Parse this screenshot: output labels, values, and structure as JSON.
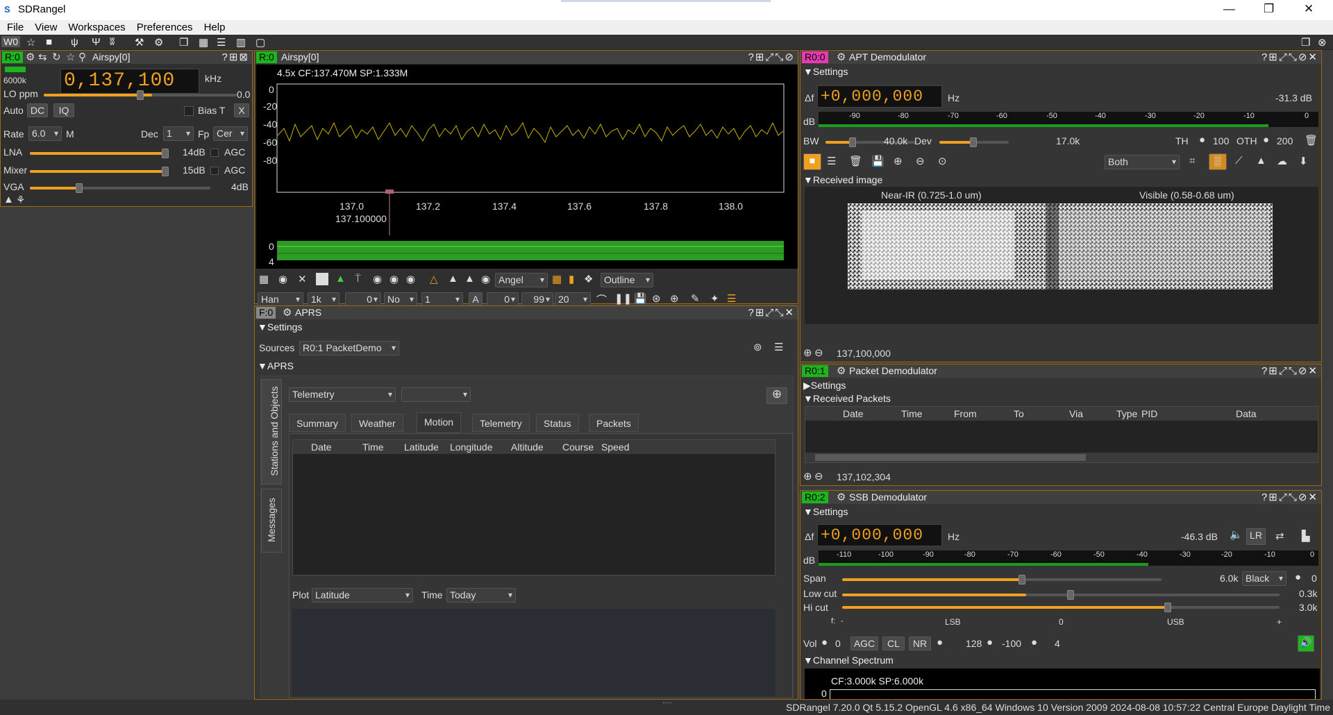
{
  "window": {
    "title": "SDRangel",
    "app_icon": "S"
  },
  "menu": [
    "File",
    "View",
    "Workspaces",
    "Preferences",
    "Help"
  ],
  "toolbar": {
    "workspace": "W0"
  },
  "device": {
    "tag": "R:0",
    "title": "Airspy[0]",
    "freq": "0,137,100",
    "unit": "kHz",
    "rate_val": "6000k",
    "lo_label": "LO ppm",
    "lo_val": "0.0",
    "auto": "Auto",
    "dc": "DC",
    "iq": "IQ",
    "biast": "Bias T",
    "x": "X",
    "rate": "Rate",
    "rate_sel": "6.0",
    "m": "M",
    "dec": "Dec",
    "dec_sel": "1",
    "fp": "Fp",
    "fp_sel": "Cer",
    "lna": "LNA",
    "lna_val": "14dB",
    "mixer": "Mixer",
    "mixer_val": "15dB",
    "vga": "VGA",
    "vga_val": "4dB",
    "agc": "AGC"
  },
  "spectrum": {
    "tag": "R:0",
    "title": "Airspy[0]",
    "info": "4.5x CF:137.470M SP:1.333M",
    "yticks": [
      "0",
      "-20",
      "-40",
      "-60",
      "-80"
    ],
    "xticks": [
      "137.0",
      "137.2",
      "137.4",
      "137.6",
      "137.8",
      "138.0"
    ],
    "marker": "137.100000",
    "wf_top": "0",
    "wf_bot": "4",
    "angel": "Angel",
    "outline": "Outline",
    "han": "Han",
    "k1": "1k",
    "zero": "0",
    "no": "No",
    "one": "1",
    "a": "A",
    "a_val": "0",
    "n99": "99",
    "n20": "20"
  },
  "aprs": {
    "tag": "F:0",
    "title": "APRS",
    "settings": "Settings",
    "sources": "Sources",
    "source_sel": "R0:1 PacketDemo",
    "aprs": "APRS",
    "telemetry_sel": "Telemetry",
    "vtab1": "Stations and Objects",
    "vtab2": "Messages",
    "tabs": [
      "Summary",
      "Weather",
      "Motion",
      "Telemetry",
      "Status",
      "Packets"
    ],
    "cols": [
      "Date",
      "Time",
      "Latitude",
      "Longitude",
      "Altitude",
      "Course",
      "Speed"
    ],
    "plot": "Plot",
    "plot_sel": "Latitude",
    "time": "Time",
    "time_sel": "Today"
  },
  "apt": {
    "tag": "R0:0",
    "title": "APT Demodulator",
    "settings": "Settings",
    "df": "Δf",
    "digits": "+0,000,000",
    "hz": "Hz",
    "level": "-31.3 dB",
    "db": "dB",
    "ticks": [
      "-90",
      "-80",
      "-70",
      "-60",
      "-50",
      "-40",
      "-30",
      "-20",
      "-10",
      "0"
    ],
    "bw": "BW",
    "bw_val": "40.0k",
    "dev": "Dev",
    "dev_val": "17.0k",
    "th_lbl": "TH",
    "th_val": "100",
    "oth_lbl": "OTH",
    "oth_val": "200",
    "both": "Both",
    "received": "Received image",
    "nearir": "Near-IR (0.725-1.0 um)",
    "visible": "Visible (0.58-0.68 um)",
    "freq": "137,100,000"
  },
  "packet": {
    "tag": "R0:1",
    "title": "Packet Demodulator",
    "settings": "Settings",
    "received": "Received Packets",
    "cols": [
      "Date",
      "Time",
      "From",
      "To",
      "Via",
      "Type",
      "PID",
      "Data"
    ],
    "freq": "137,102,304"
  },
  "ssb": {
    "tag": "R0:2",
    "title": "SSB Demodulator",
    "settings": "Settings",
    "df": "Δf",
    "digits": "+0,000,000",
    "hz": "Hz",
    "level": "-46.3 dB",
    "lr": "LR",
    "db": "dB",
    "ticks": [
      "-110",
      "-100",
      "-90",
      "-80",
      "-70",
      "-60",
      "-50",
      "-40",
      "-30",
      "-20",
      "-10",
      "0"
    ],
    "span": "Span",
    "span_val": "6.0k",
    "black": "Black",
    "zero": "0",
    "lowcut": "Low cut",
    "low_val": "0.3k",
    "hicut": "Hi cut",
    "hi_val": "3.0k",
    "f": "f:",
    "minus": "-",
    "lsb": "LSB",
    "fzero": "0",
    "usb": "USB",
    "plus": "+",
    "vol": "Vol",
    "vol_val": "0",
    "agc": "AGC",
    "cl": "CL",
    "nr": "NR",
    "n128": "128",
    "n100": "-100",
    "n4": "4",
    "chspec": "Channel Spectrum",
    "cf": "CF:3.000k SP:6.000k",
    "ch0": "0"
  },
  "status": "SDRangel 7.20.0 Qt 5.15.2 OpenGL 4.6 x86_64 Windows 10 Version 2009 2024-08-08 10:57:22 Central Europe Daylight Time"
}
